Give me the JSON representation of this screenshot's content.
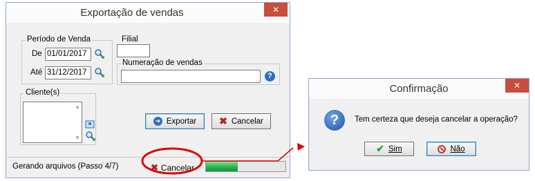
{
  "export_window": {
    "title": "Exportação de vendas",
    "close_glyph": "✕",
    "periodo": {
      "group_label": "Período de Venda",
      "de_label": "De",
      "de_value": "01/01/2017",
      "ate_label": "Até",
      "ate_value": "31/12/2017"
    },
    "filial": {
      "label": "Filial",
      "value": ""
    },
    "numeracao": {
      "label": "Numeração de vendas",
      "value": "",
      "help_glyph": "?"
    },
    "clientes": {
      "label": "Cliente(s)"
    },
    "buttons": {
      "exportar": "Exportar",
      "cancelar": "Cancelar"
    },
    "status": {
      "text": "Gerando arquivos (Passo 4/7)",
      "cancel_label": "Cancelar",
      "progress": 0.4
    }
  },
  "confirm_dialog": {
    "title": "Confirmação",
    "close_glyph": "✕",
    "message": "Tem certeza que deseja cancelar a operação?",
    "question_glyph": "?",
    "yes_label": "Sim",
    "no_label": "Não"
  },
  "colors": {
    "close_red": "#c74d3e",
    "highlight_red": "#e00000",
    "progress_green": "#22b14c",
    "help_blue": "#2f6fc0"
  }
}
